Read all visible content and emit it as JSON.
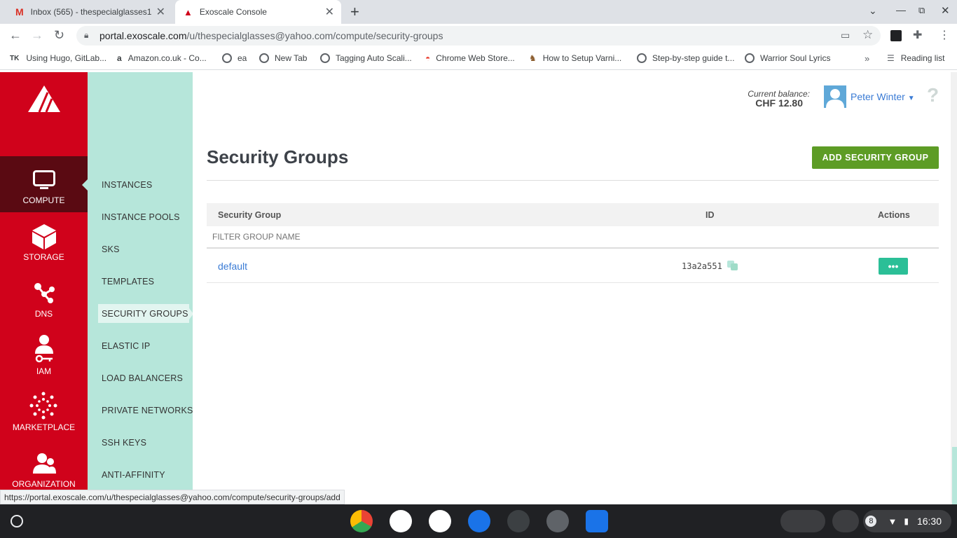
{
  "browser": {
    "tabs": [
      {
        "title": "Inbox (565) - thespecialglasses1",
        "active": false
      },
      {
        "title": "Exoscale Console",
        "active": true
      }
    ],
    "url_host": "portal.exoscale.com",
    "url_path": "/u/thespecialglasses@yahoo.com/compute/security-groups",
    "bookmarks": [
      "Using Hugo, GitLab...",
      "Amazon.co.uk - Co...",
      "ea",
      "New Tab",
      "Tagging Auto Scali...",
      "Chrome Web Store...",
      "How to Setup Varni...",
      "Step-by-step guide t...",
      "Warrior Soul Lyrics"
    ],
    "reading_list": "Reading list",
    "status_url": "https://portal.exoscale.com/u/thespecialglasses@yahoo.com/compute/security-groups/add"
  },
  "rail": {
    "items": [
      {
        "label": "COMPUTE",
        "icon": "monitor-icon"
      },
      {
        "label": "STORAGE",
        "icon": "box-icon"
      },
      {
        "label": "DNS",
        "icon": "dns-icon"
      },
      {
        "label": "IAM",
        "icon": "iam-icon"
      },
      {
        "label": "MARKETPLACE",
        "icon": "marketplace-icon"
      },
      {
        "label": "ORGANIZATION",
        "icon": "organization-icon"
      }
    ]
  },
  "subnav": {
    "items": [
      "INSTANCES",
      "INSTANCE POOLS",
      "SKS",
      "TEMPLATES",
      "SECURITY GROUPS",
      "ELASTIC IP",
      "LOAD BALANCERS",
      "PRIVATE NETWORKS",
      "SSH KEYS",
      "ANTI-AFFINITY"
    ],
    "active": "SECURITY GROUPS"
  },
  "header": {
    "balance_label": "Current balance:",
    "balance_value": "CHF 12.80",
    "user_name": "Peter Winter",
    "help": "?"
  },
  "page": {
    "title": "Security Groups",
    "add_button": "ADD SECURITY GROUP",
    "columns": [
      "Security Group",
      "ID",
      "Actions"
    ],
    "filter_placeholder": "FILTER GROUP NAME",
    "rows": [
      {
        "name": "default",
        "id": "13a2a551",
        "action": "•••"
      }
    ]
  },
  "shelf": {
    "notifications": "8",
    "time": "16:30"
  },
  "colors": {
    "rail": "#d0021b",
    "subnav": "#b6e6da",
    "add_button": "#5d9c25",
    "action_button": "#2bbf97",
    "link": "#3a7bd5"
  }
}
